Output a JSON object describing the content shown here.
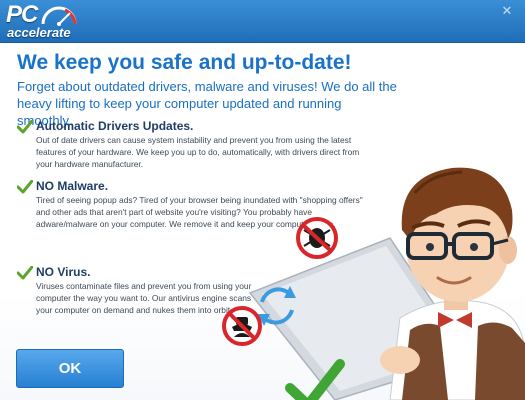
{
  "app": {
    "logo_main": "PC",
    "logo_sub": "accelerate"
  },
  "window": {
    "close_glyph": "✕"
  },
  "headline": "We keep you safe and up-to-date!",
  "intro": "Forget about outdated drivers, malware and viruses! We do all the heavy lifting to keep your computer updated and running smoothly.",
  "features": [
    {
      "title": "Automatic Drivers Updates.",
      "desc": "Out of date drivers can cause system instability and prevent you from using the latest features of your hardware. We keep you up to do, automatically, with drivers direct from your hardware manufacturer."
    },
    {
      "title": "NO Malware.",
      "desc": "Tired of seeing popup ads? Tired of your browser being inundated with \"shopping offers\" and other ads that aren't part of website you're visiting? You probably have adware/malware on your computer. We remove it and keep your computer clean."
    },
    {
      "title": "NO Virus.",
      "desc": "Viruses contaminate files and prevent you from using your computer the way you want to. Our antivirus engine scans your computer on demand and nukes them into orbit."
    }
  ],
  "ok_button": "OK",
  "colors": {
    "accent": "#1a73c9",
    "check": "#5aa52c",
    "prohibit": "#d9262a",
    "button": "#3b93df"
  },
  "icons": [
    "close-icon",
    "speedometer-icon",
    "check-icon",
    "no-bug-icon",
    "no-spy-icon",
    "refresh-icon"
  ]
}
